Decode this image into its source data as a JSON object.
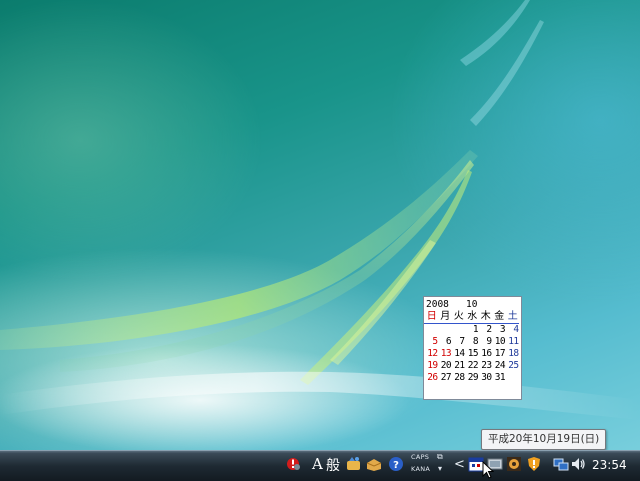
{
  "calendar": {
    "year": "2008",
    "month": "10",
    "weekdays": [
      "日",
      "月",
      "火",
      "水",
      "木",
      "金",
      "土"
    ],
    "weeks": [
      [
        "",
        "",
        "",
        "1",
        "2",
        "3",
        "4"
      ],
      [
        "5",
        "6",
        "7",
        "8",
        "9",
        "10",
        "11"
      ],
      [
        "12",
        "13",
        "14",
        "15",
        "16",
        "17",
        "18"
      ],
      [
        "19",
        "20",
        "21",
        "22",
        "23",
        "24",
        "25"
      ],
      [
        "26",
        "27",
        "28",
        "29",
        "30",
        "31",
        ""
      ]
    ],
    "holidays": [
      "13"
    ],
    "sunday_color": "#d10000",
    "saturday_color": "#1f3a9a"
  },
  "tooltip": {
    "text": "平成20年10月19日(日)"
  },
  "taskbar": {
    "language": {
      "indicator": "A",
      "ime_mode": "般"
    },
    "caps_label": "CAPS",
    "kana_label": "KANA",
    "show_hidden_icons": "<",
    "clock": "23:54",
    "tray_icons": [
      "red-exclamation-icon",
      "ime-pad-icon",
      "ime-tool-icon",
      "help-icon",
      "calendar-icon",
      "device-icon",
      "app-icon",
      "security-shield-icon",
      "network-icon",
      "volume-icon"
    ]
  }
}
